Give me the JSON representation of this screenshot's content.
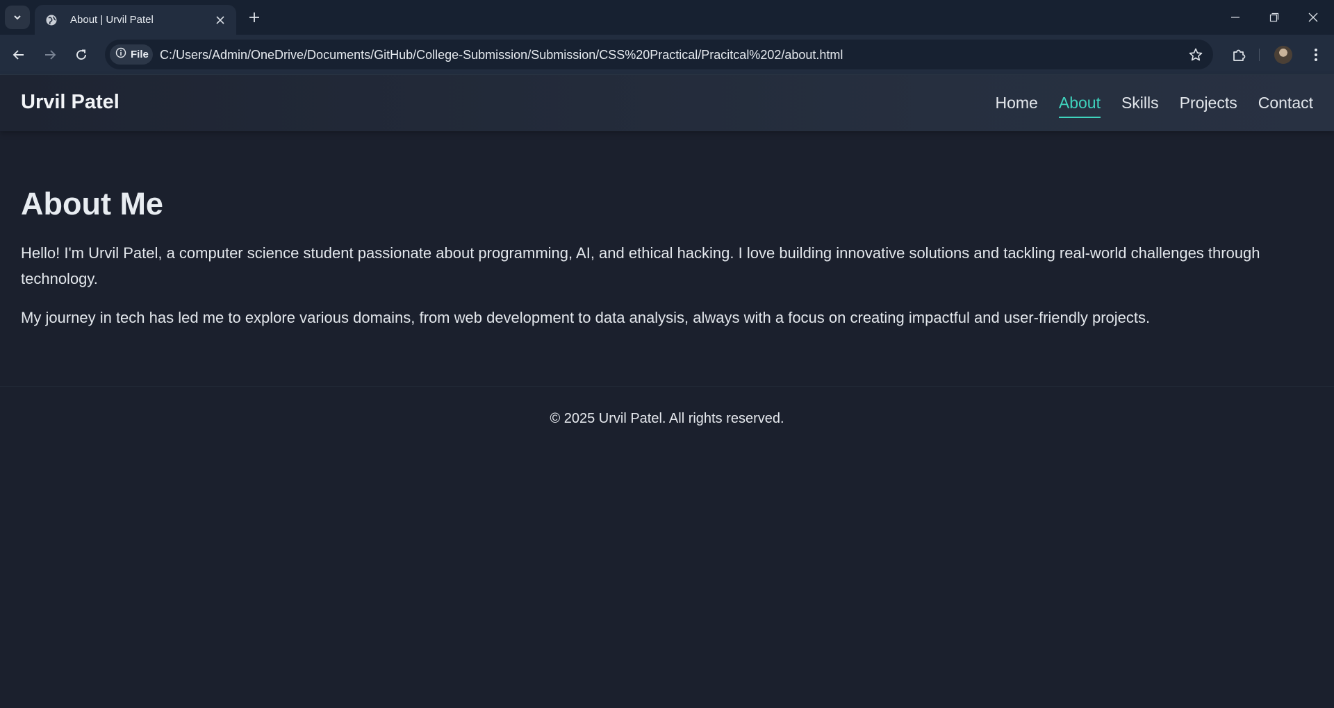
{
  "browser": {
    "tab_title": "About | Urvil Patel",
    "address_chip": "File",
    "url": "C:/Users/Admin/OneDrive/Documents/GitHub/College-Submission/Submission/CSS%20Practical/Pracitcal%202/about.html",
    "icons": [
      "tab-search-icon",
      "globe-icon",
      "close-icon",
      "new-tab-icon",
      "minimize-icon",
      "restore-icon",
      "window-close-icon",
      "back-icon",
      "forward-icon",
      "reload-icon",
      "info-icon",
      "star-icon",
      "extensions-icon",
      "avatar",
      "more-icon"
    ]
  },
  "site": {
    "brand": "Urvil Patel",
    "nav": [
      {
        "label": "Home",
        "active": false
      },
      {
        "label": "About",
        "active": true
      },
      {
        "label": "Skills",
        "active": false
      },
      {
        "label": "Projects",
        "active": false
      },
      {
        "label": "Contact",
        "active": false
      }
    ],
    "heading": "About Me",
    "paragraphs": [
      "Hello! I'm Urvil Patel, a computer science student passionate about programming, AI, and ethical hacking. I love building innovative solutions and tackling real-world challenges through technology.",
      "My journey in tech has led me to explore various domains, from web development to data analysis, always with a focus on creating impactful and user-friendly projects."
    ],
    "footer": "© 2025 Urvil Patel. All rights reserved."
  },
  "colors": {
    "page_bg": "#1b202d",
    "accent": "#3fd3bd",
    "chrome_bg": "#172131",
    "toolbar_bg": "#222d3f"
  }
}
